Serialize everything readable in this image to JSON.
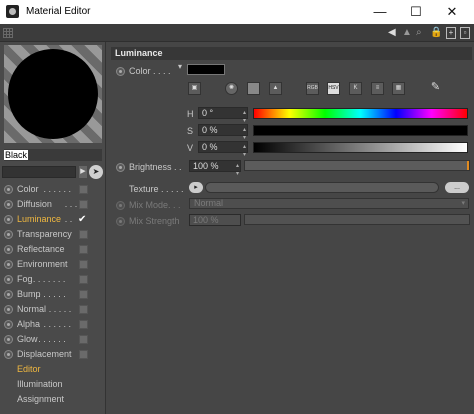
{
  "window": {
    "title": "Material Editor",
    "minimize": "—",
    "maximize": "☐",
    "close": "✕"
  },
  "preview": {
    "material_name": "Black"
  },
  "channels": [
    {
      "label": "Color",
      "dots": " . . . . . .",
      "checked": false,
      "active": false
    },
    {
      "label": "Diffusion",
      "dots": " . . .",
      "checked": false,
      "active": false
    },
    {
      "label": "Luminance",
      "dots": " . .",
      "checked": true,
      "active": true
    },
    {
      "label": "Transparency",
      "dots": "",
      "checked": false,
      "active": false
    },
    {
      "label": "Reflectance",
      "dots": "",
      "checked": false,
      "active": false
    },
    {
      "label": "Environment",
      "dots": "",
      "checked": false,
      "active": false
    },
    {
      "label": "Fog",
      "dots": " . . . . . . .",
      "checked": false,
      "active": false
    },
    {
      "label": "Bump",
      "dots": " . . . . . .",
      "checked": false,
      "active": false
    },
    {
      "label": "Normal",
      "dots": " . . . . .",
      "checked": false,
      "active": false
    },
    {
      "label": "Alpha",
      "dots": " . . . . . .",
      "checked": false,
      "active": false
    },
    {
      "label": "Glow",
      "dots": " . . . . . .",
      "checked": false,
      "active": false
    },
    {
      "label": "Displacement",
      "dots": "",
      "checked": false,
      "active": false
    }
  ],
  "extra": [
    {
      "label": "Editor",
      "active": true
    },
    {
      "label": "Illumination",
      "active": false
    },
    {
      "label": "Assignment",
      "active": false
    }
  ],
  "panel": {
    "section_title": "Luminance",
    "color_label": "Color . . . .",
    "color_value": "#000000",
    "picker_icons": [
      "image",
      "wheel",
      "spectrum",
      "picture",
      "RGB",
      "HSV",
      "K",
      "mixer",
      "swatches"
    ],
    "h": {
      "label": "H",
      "value": "0 °"
    },
    "s": {
      "label": "S",
      "value": "0 %"
    },
    "v": {
      "label": "V",
      "value": "0 %"
    },
    "brightness": {
      "label": "Brightness . .",
      "value": "100 %",
      "level": 1.0
    },
    "texture": {
      "label": "Texture . . . . .",
      "more": "..."
    },
    "mix_mode": {
      "label": "Mix Mode. . .",
      "value": "Normal"
    },
    "mix_strength": {
      "label": "Mix Strength",
      "value": "100 %"
    }
  },
  "colors": {
    "accent": "#f0b840"
  }
}
